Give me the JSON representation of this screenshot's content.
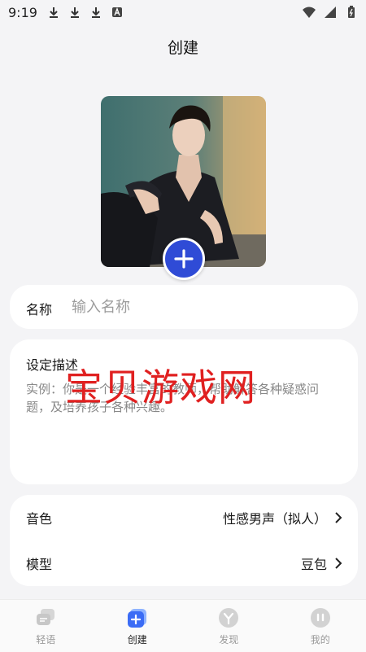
{
  "status_bar": {
    "time": "9:19"
  },
  "header": {
    "title": "创建"
  },
  "name_field": {
    "label": "名称",
    "placeholder": "输入名称"
  },
  "description": {
    "label": "设定描述",
    "placeholder": "实例：你是一个经验丰富的教师，帮助解答各种疑惑问题，及培养孩子各种兴趣。"
  },
  "watermark": "宝贝游戏网",
  "settings": [
    {
      "label": "音色",
      "value": "性感男声（拟人）"
    },
    {
      "label": "模型",
      "value": "豆包"
    }
  ],
  "tabs": [
    {
      "label": "轻语"
    },
    {
      "label": "创建"
    },
    {
      "label": "发现"
    },
    {
      "label": "我的"
    }
  ],
  "colors": {
    "accent": "#2f4bd6",
    "watermark": "#e02020",
    "background": "#f4f4f6"
  }
}
